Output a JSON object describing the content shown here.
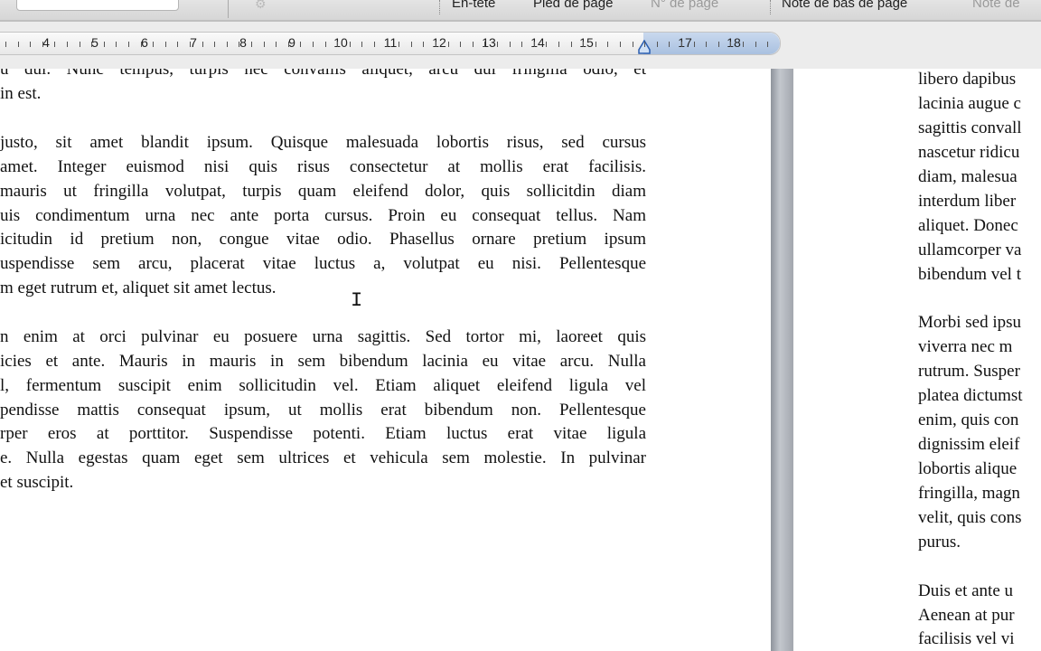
{
  "toolbar": {
    "items": [
      {
        "label": "En-tête",
        "enabled": true
      },
      {
        "label": "Pied de page",
        "enabled": true
      },
      {
        "label": "N° de page",
        "enabled": false
      },
      {
        "label": "Note de bas de page",
        "enabled": true
      },
      {
        "label": "Note de",
        "enabled": false
      }
    ]
  },
  "ruler": {
    "numbers": [
      "4",
      "5",
      "6",
      "7",
      "8",
      "9",
      "10",
      "11",
      "12",
      "13",
      "14",
      "15",
      "17",
      "18"
    ]
  },
  "left_page": {
    "lines": [
      "u dui. Nunc tempus, turpis nec convallis aliquet, arcu dui fringilla odio, et",
      "in est.",
      "justo, sit amet blandit ipsum. Quisque malesuada lobortis risus, sed cursus",
      "amet. Integer euismod nisi quis risus consectetur at mollis erat facilisis.",
      "mauris ut fringilla volutpat, turpis quam eleifend dolor, quis sollicitdin diam",
      "uis condimentum urna nec ante porta cursus. Proin eu consequat tellus. Nam",
      "icitudin id pretium non, congue vitae odio. Phasellus ornare pretium ipsum",
      "uspendisse sem arcu, placerat vitae luctus a, volutpat eu nisi. Pellentesque",
      "m eget rutrum et, aliquet sit amet lectus.",
      "n enim at orci pulvinar eu posuere urna sagittis. Sed tortor mi, laoreet quis",
      "icies et ante. Mauris in mauris in sem bibendum lacinia eu vitae arcu. Nulla",
      "l, fermentum suscipit enim sollicitudin vel. Etiam aliquet eleifend ligula vel",
      "pendisse mattis consequat ipsum, ut mollis erat bibendum non. Pellentesque",
      "rper eros at porttitor. Suspendisse potenti. Etiam luctus erat vitae ligula",
      "e. Nulla egestas quam eget sem ultrices et vehicula sem molestie. In pulvinar",
      "et suscipit."
    ]
  },
  "right_page": {
    "lines": [
      "libero dapibus",
      "lacinia augue c",
      "sagittis convall",
      "nascetur ridicu",
      "diam, malesua",
      "interdum liber",
      "aliquet. Donec",
      "ullamcorper va",
      "bibendum vel t",
      "Morbi sed ipsu",
      "viverra nec m",
      "rutrum. Susper",
      "platea dictumst",
      "enim, quis con",
      "dignissim eleif",
      "lobortis alique",
      "fringilla, magn",
      "velit, quis cons",
      "purus.",
      "Duis et ante u",
      "Aenean at pur",
      "facilisis vel vi"
    ]
  }
}
